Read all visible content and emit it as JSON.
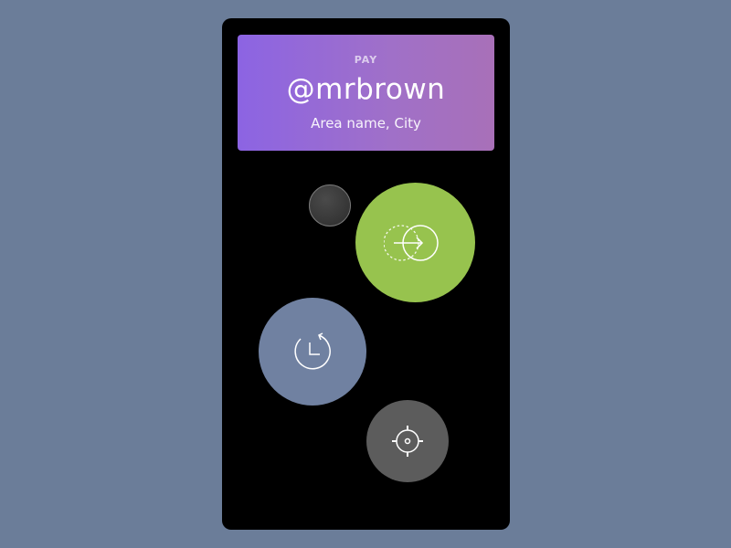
{
  "card": {
    "label": "PAY",
    "handle": "@mrbrown",
    "location": "Area name, City"
  },
  "actions": [
    {
      "name": "more-options",
      "icon": "blank-circle",
      "color": "#3a3a3a"
    },
    {
      "name": "sign-in",
      "icon": "enter-arrow-icon",
      "color": "#97c34e"
    },
    {
      "name": "history",
      "icon": "history-clock-icon",
      "color": "#7081a1"
    },
    {
      "name": "settings",
      "icon": "gear-icon",
      "color": "#5c5c5c"
    }
  ],
  "colors": {
    "background": "#6b7d99",
    "phone": "#000000",
    "card_gradient_start": "#8c64e3",
    "card_gradient_end": "#a870b8"
  }
}
